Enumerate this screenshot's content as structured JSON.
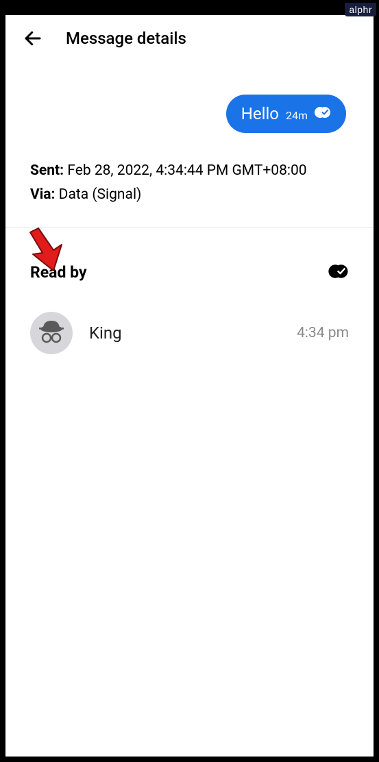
{
  "header": {
    "title": "Message details"
  },
  "message": {
    "text": "Hello",
    "relative_time": "24m"
  },
  "meta": {
    "sent_label": "Sent:",
    "sent_value": "Feb 28, 2022, 4:34:44 PM GMT+08:00",
    "via_label": "Via:",
    "via_value": "Data (Signal)"
  },
  "readby": {
    "heading": "Read by",
    "readers": [
      {
        "name": "King",
        "time": "4:34 pm"
      }
    ]
  },
  "watermark": "alphr"
}
